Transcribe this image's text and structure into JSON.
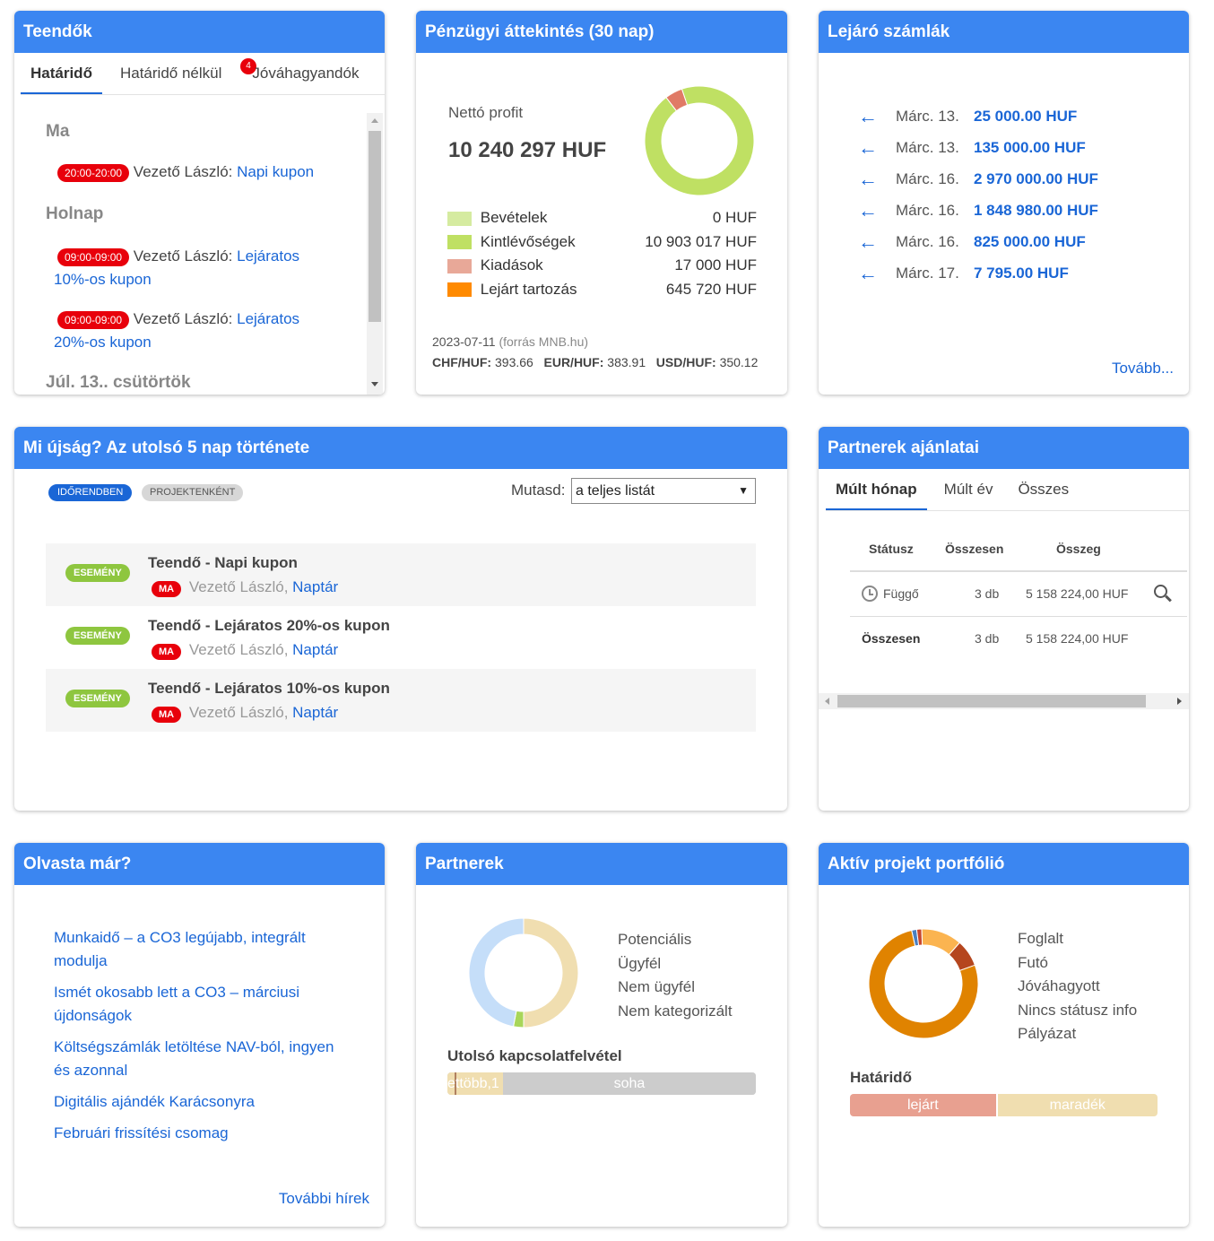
{
  "teendok": {
    "title": "Teendők",
    "tabs": [
      {
        "label": "Határidő"
      },
      {
        "label": "Határidő nélkül"
      },
      {
        "label": "Jóváhagyandók"
      }
    ],
    "badge": "4",
    "groups": {
      "ma": "Ma",
      "holnap": "Holnap",
      "jul": "Júl. 13., csütörtök"
    },
    "items": [
      {
        "time": "20:00-20:00",
        "person": "Vezető László:",
        "link": "Napi kupon"
      },
      {
        "time": "09:00-09:00",
        "person": "Vezető László:",
        "link_line1": "Lejáratos",
        "link_line2": "10%-os kupon"
      },
      {
        "time": "09:00-09:00",
        "person": "Vezető László:",
        "link_line1": "Lejáratos",
        "link_line2": "20%-os kupon"
      }
    ]
  },
  "penzugy": {
    "title": "Pénzügyi áttekintés (30 nap)",
    "net_label": "Nettó profit",
    "net_value": "10 240 297 HUF",
    "legend": [
      {
        "label": "Bevételek",
        "value": "0 HUF",
        "color": "#d5eba0"
      },
      {
        "label": "Kintlévőségek",
        "value": "10 903 017 HUF",
        "color": "#bfe063"
      },
      {
        "label": "Kiadások",
        "value": "17 000 HUF",
        "color": "#e8a898"
      },
      {
        "label": "Lejárt tartozás",
        "value": "645 720 HUF",
        "color": "#ff8a00"
      }
    ],
    "donut_fractions": {
      "kintlevoseg": 0.948,
      "kiadas": 0.052
    },
    "rates_date": "2023-07-11",
    "rates_source": "(forrás MNB.hu)",
    "chf_label": "CHF/HUF:",
    "chf_value": "393.66",
    "eur_label": "EUR/HUF:",
    "eur_value": "383.91",
    "usd_label": "USD/HUF:",
    "usd_value": "350.12"
  },
  "lejaro": {
    "title": "Lejáró számlák",
    "rows": [
      {
        "date": "Márc. 13.",
        "amount": "25 000.00 HUF"
      },
      {
        "date": "Márc. 13.",
        "amount": "135 000.00 HUF"
      },
      {
        "date": "Márc. 16.",
        "amount": "2 970 000.00 HUF"
      },
      {
        "date": "Márc. 16.",
        "amount": "1 848 980.00 HUF"
      },
      {
        "date": "Márc. 16.",
        "amount": "825 000.00 HUF"
      },
      {
        "date": "Márc. 17.",
        "amount": "7 795.00 HUF"
      }
    ],
    "more": "Tovább..."
  },
  "ujsag": {
    "title": "Mi újság? Az utolsó 5 nap története",
    "tag_time": "IDŐRENDBEN",
    "tag_project": "PROJEKTENKÉNT",
    "show_label": "Mutasd:",
    "show_value": "a teljes listát",
    "events": [
      {
        "tag": "ESEMÉNY",
        "title": "Teendő - Napi kupon",
        "day": "MA",
        "person": "Vezető László,",
        "link": "Naptár"
      },
      {
        "tag": "ESEMÉNY",
        "title": "Teendő - Lejáratos 20%-os kupon",
        "day": "MA",
        "person": "Vezető László,",
        "link": "Naptár"
      },
      {
        "tag": "ESEMÉNY",
        "title": "Teendő - Lejáratos 10%-os kupon",
        "day": "MA",
        "person": "Vezető László,",
        "link": "Naptár"
      }
    ]
  },
  "partner_ajanlat": {
    "title": "Partnerek ajánlatai",
    "tabs": [
      {
        "label": "Múlt hónap"
      },
      {
        "label": "Múlt év"
      },
      {
        "label": "Összes"
      }
    ],
    "cols": {
      "status": "Státusz",
      "total": "Összesen",
      "sum": "Összeg"
    },
    "row": {
      "status": "Függő",
      "count": "3 db",
      "sum": "5 158 224,00 HUF"
    },
    "total_row": {
      "label": "Összesen",
      "count": "3 db",
      "sum": "5 158 224,00 HUF"
    }
  },
  "olvasta": {
    "title": "Olvasta már?",
    "links": [
      {
        "l1": "Munkaidő – a CO3 legújabb, integrált",
        "l2": "modulja"
      },
      {
        "l1": "Ismét okosabb lett a CO3 – márciusi",
        "l2": "újdonságok"
      },
      {
        "l1": "Költségszámlák letöltése NAV-ból, ingyen",
        "l2": "és azonnal"
      },
      {
        "l1": "Digitális ajándék Karácsonyra",
        "l2": ""
      },
      {
        "l1": "Februári frissítési csomag",
        "l2": ""
      }
    ],
    "more": "További hírek"
  },
  "partnerek": {
    "title": "Partnerek",
    "legend": [
      "Potenciális",
      "Ügyfél",
      "Nem ügyfél",
      "Nem kategorizált"
    ],
    "donut_fractions": [
      0.5,
      0.03,
      0.47
    ],
    "colors": [
      "#f0deb0",
      "#a8d65a",
      "#c5def9"
    ],
    "contact_title": "Utolsó kapcsolatfelvétel",
    "bar_label_small": "ettöbb,1",
    "bar_label_never": "soha",
    "bar_fractions": {
      "recent": 0.18,
      "never": 0.82
    }
  },
  "portfolio": {
    "title": "Aktív projekt portfólió",
    "legend": [
      "Foglalt",
      "Futó",
      "Jóváhagyott",
      "Nincs státusz info",
      "Pályázat"
    ],
    "donut_fractions": [
      0.015,
      0.015,
      0.12,
      0.08,
      0.77
    ],
    "colors": [
      "#4a7fc0",
      "#c8472e",
      "#fbb450",
      "#b5461e",
      "#e08300"
    ],
    "deadline_title": "Határidő",
    "bar_expired": "lejárt",
    "bar_remaining": "maradék",
    "bar_fractions": {
      "expired": 0.48,
      "remaining": 0.52
    }
  }
}
